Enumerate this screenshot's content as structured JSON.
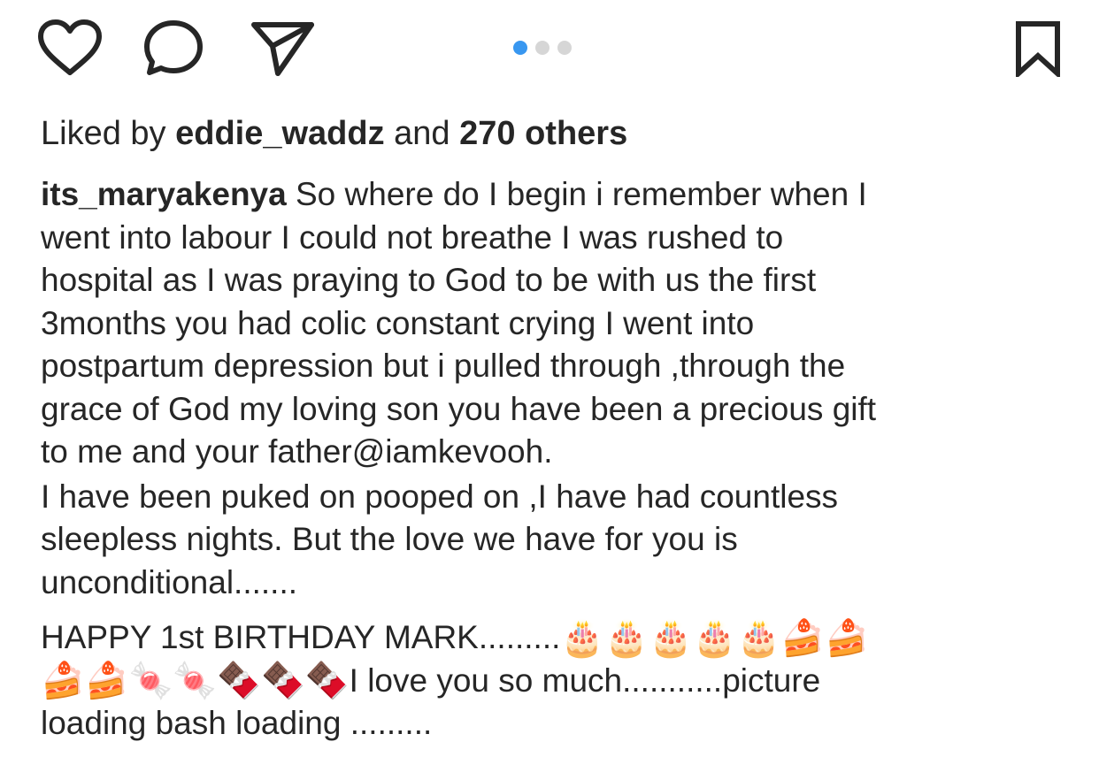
{
  "actions": {
    "like_icon": "heart-icon",
    "comment_icon": "comment-bubble-icon",
    "share_icon": "paper-plane-icon",
    "save_icon": "bookmark-icon"
  },
  "carousel": {
    "total": 3,
    "active_index": 0,
    "active_color": "#3897f0",
    "inactive_color": "#d6d6d6"
  },
  "likes": {
    "prefix": "Liked by ",
    "user": "eddie_waddz",
    "middle": " and ",
    "count": "270 others"
  },
  "caption": {
    "username": "its_maryakenya",
    "lines": [
      " So where do I begin i remember when I",
      "went into labour I could not breathe I was rushed to",
      "hospital as I was praying to God to be with us the first",
      "3months you had colic constant crying I went into",
      "postpartum depression  but i pulled through ,through the",
      "grace of God  my loving son you have been a precious gift",
      "to me and your father@iamkevooh.",
      "I have been puked on pooped on ,I have had countless",
      "sleepless nights. But the love we have for you is",
      "unconditional.......",
      "HAPPY 1st  BIRTHDAY MARK.........",
      "🎂🎂🎂🎂🎂🍰🍰",
      "🍰🍰🍬🍬🍫🍫🍫",
      "I love you so much...........picture",
      "loading bash loading ........."
    ]
  }
}
